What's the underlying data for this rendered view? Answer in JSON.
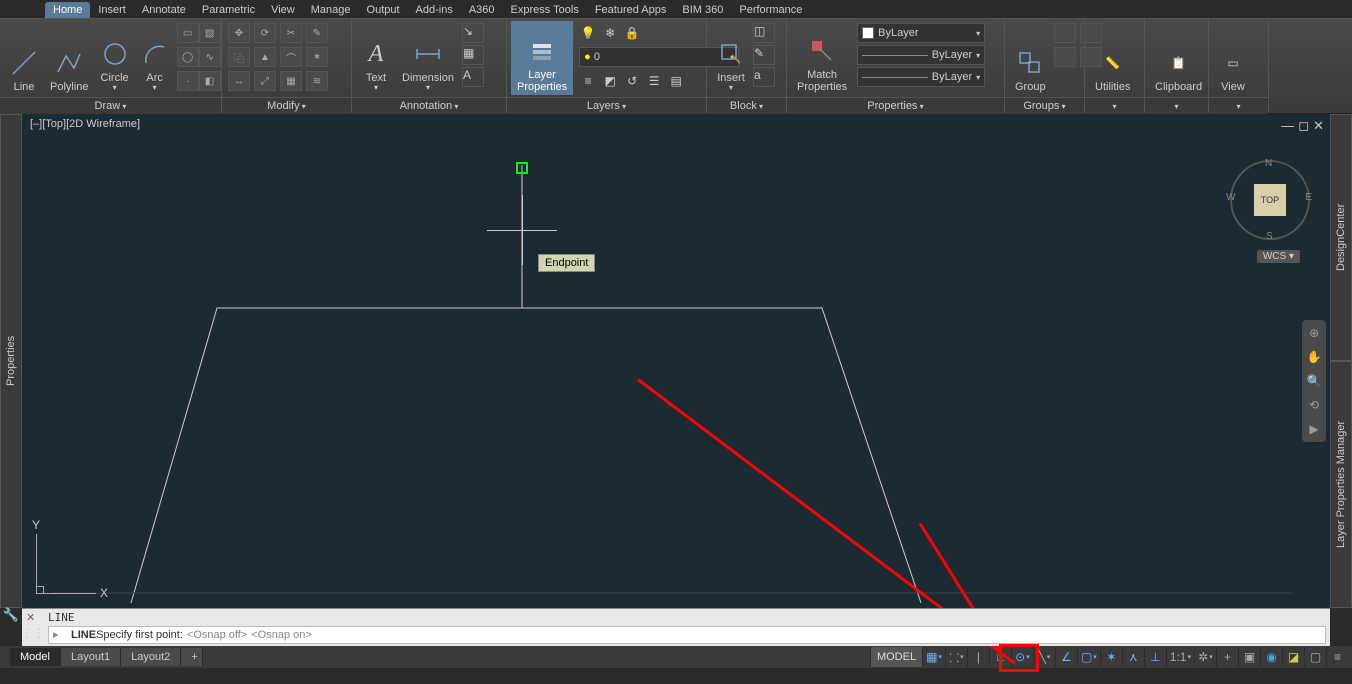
{
  "tabs": [
    "Home",
    "Insert",
    "Annotate",
    "Parametric",
    "View",
    "Manage",
    "Output",
    "Add-ins",
    "A360",
    "Express Tools",
    "Featured Apps",
    "BIM 360",
    "Performance"
  ],
  "active_tab": "Home",
  "panels": {
    "draw": {
      "title": "Draw",
      "buttons": [
        "Line",
        "Polyline",
        "Circle",
        "Arc"
      ]
    },
    "modify": {
      "title": "Modify"
    },
    "annotation": {
      "title": "Annotation",
      "buttons": [
        "Text",
        "Dimension"
      ]
    },
    "layers": {
      "title": "Layers",
      "btn": "Layer\nProperties",
      "combo": "0"
    },
    "block": {
      "title": "Block",
      "btn": "Insert"
    },
    "properties": {
      "title": "Properties",
      "btn": "Match\nProperties",
      "color": "ByLayer",
      "ltype": "ByLayer",
      "lweight": "ByLayer"
    },
    "groups": {
      "title": "Groups",
      "btn": "Group"
    },
    "utilities": {
      "title": "Utilities"
    },
    "clipboard": {
      "title": "Clipboard"
    },
    "view": {
      "title": "View"
    }
  },
  "viewport": {
    "label": "[–][Top][2D Wireframe]",
    "tooltip": "Endpoint",
    "viewcube": "TOP",
    "wcs": "WCS",
    "ucs_x": "X",
    "ucs_y": "Y"
  },
  "side_panels": {
    "left": "Properties",
    "right_top": "DesignCenter",
    "right_bottom": "Layer Properties Manager"
  },
  "command": {
    "history": "LINE",
    "prompt_cmd": "LINE",
    "prompt_text": " Specify first point:  ",
    "osnap_off": "<Osnap off>",
    "osnap_on": "<Osnap on>"
  },
  "bottom_tabs": [
    "Model",
    "Layout1",
    "Layout2"
  ],
  "status": {
    "model": "MODEL",
    "scale": "1:1"
  }
}
